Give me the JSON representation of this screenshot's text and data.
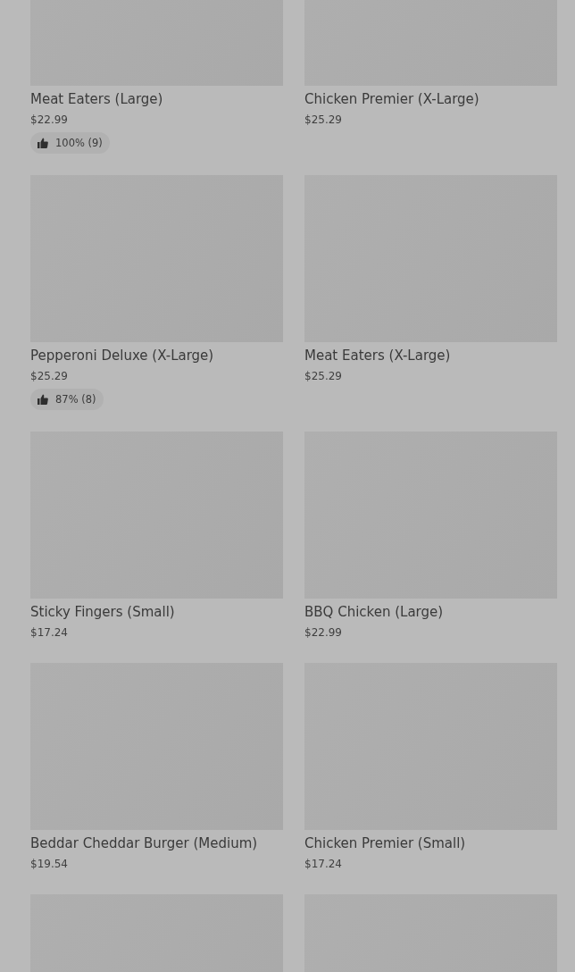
{
  "products": [
    {
      "kind": "product",
      "name": "Meat Eaters (Large)",
      "price": "$22.99",
      "rating": "100% (9)"
    },
    {
      "kind": "product",
      "name": "Chicken Premier (X-Large)",
      "price": "$25.29"
    },
    {
      "kind": "product",
      "name": "Pepperoni Deluxe (X-Large)",
      "price": "$25.29",
      "rating": "87% (8)"
    },
    {
      "kind": "product",
      "name": "Meat Eaters (X-Large)",
      "price": "$25.29"
    },
    {
      "kind": "product",
      "name": "Sticky Fingers (Small)",
      "price": "$17.24"
    },
    {
      "kind": "product",
      "name": "BBQ Chicken (Large)",
      "price": "$22.99"
    },
    {
      "kind": "product",
      "name": "Beddar Cheddar Burger (Medium)",
      "price": "$19.54"
    },
    {
      "kind": "product",
      "name": "Chicken Premier (Small)",
      "price": "$17.24"
    },
    {
      "kind": "picture"
    },
    {
      "kind": "picture"
    }
  ]
}
